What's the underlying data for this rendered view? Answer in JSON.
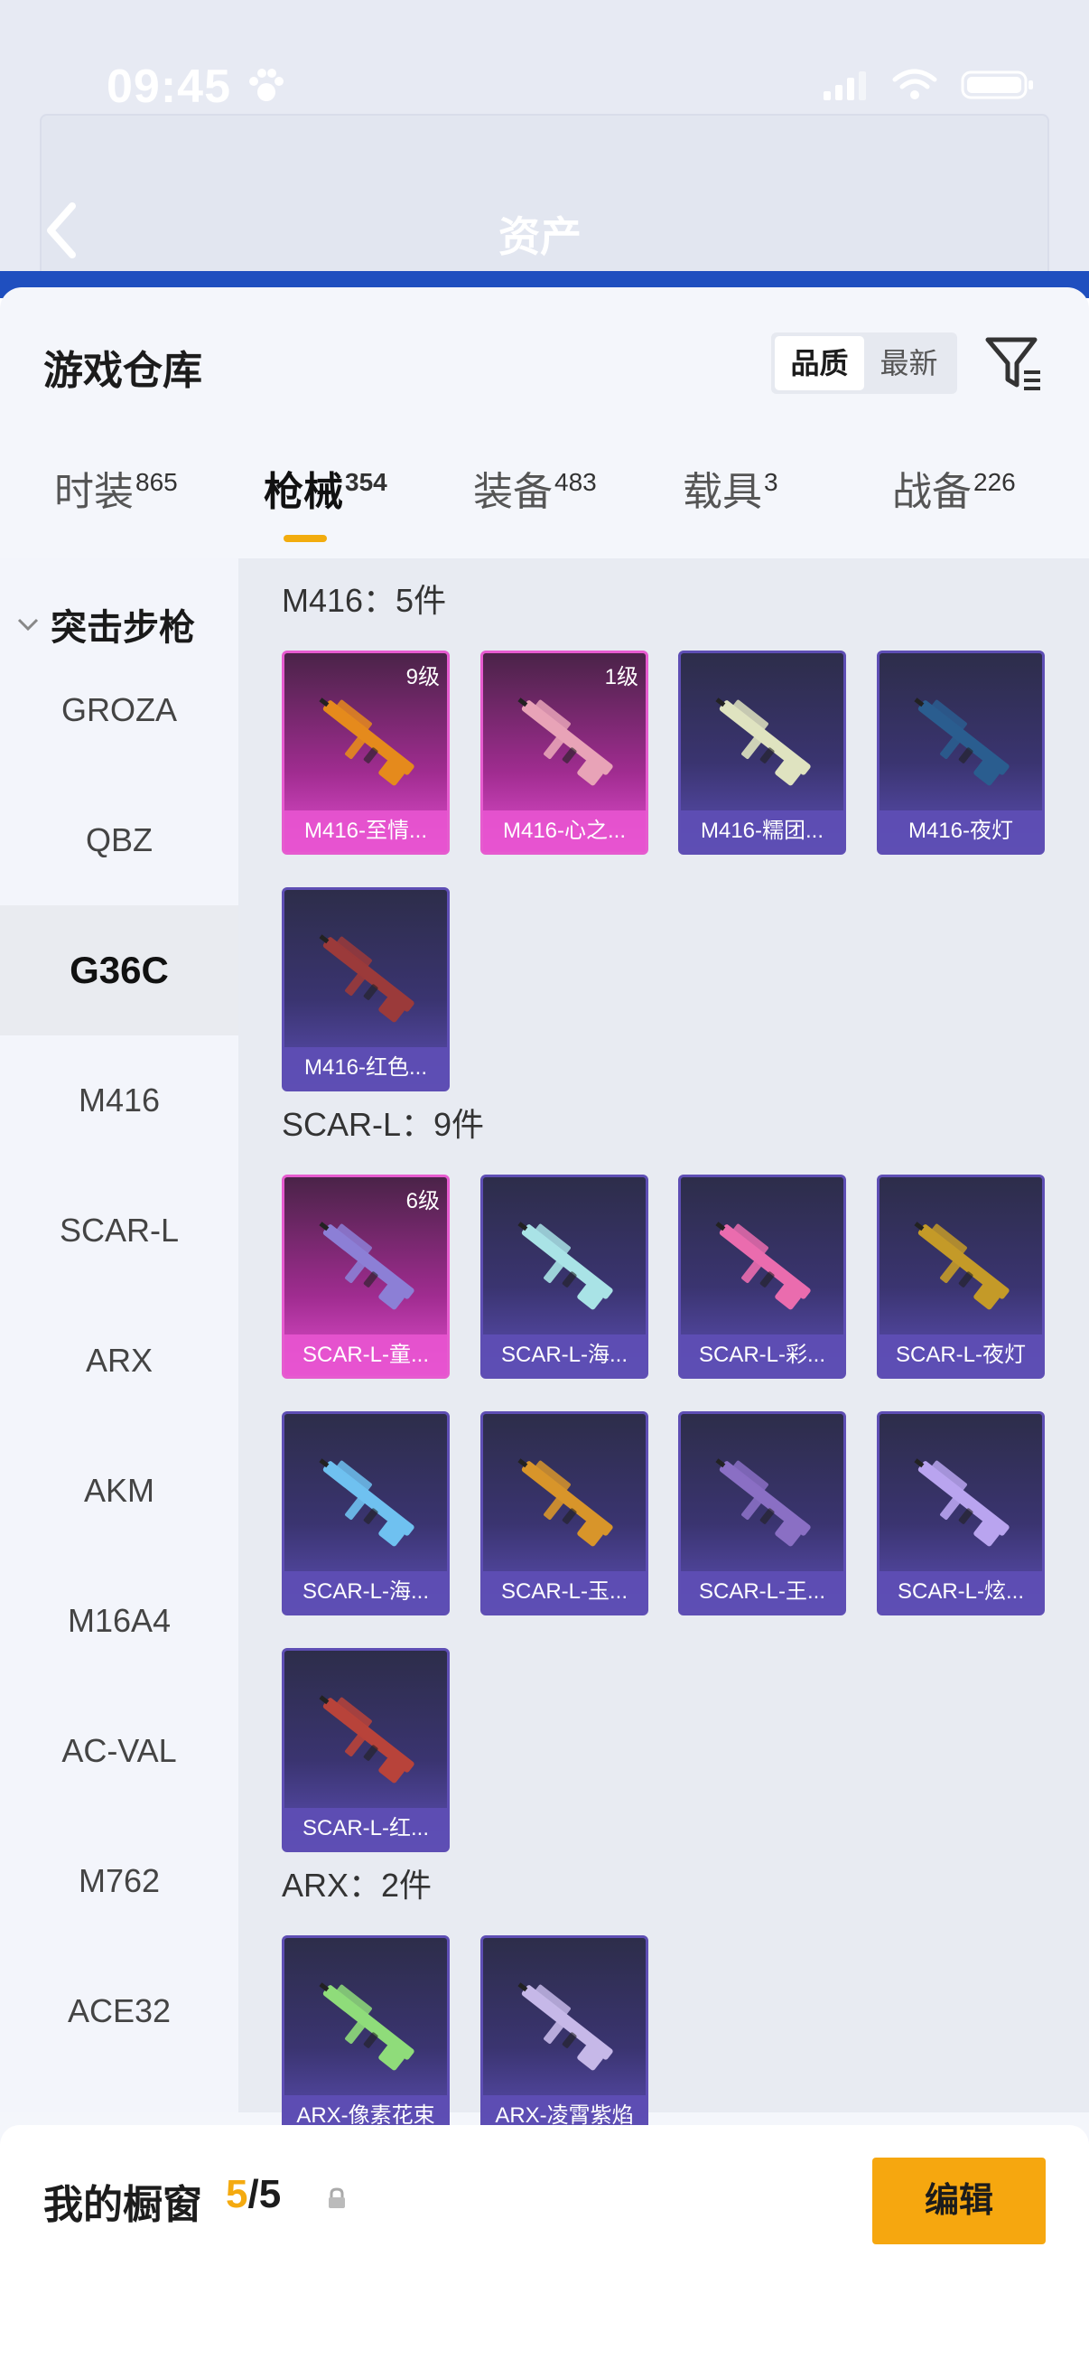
{
  "status_bar": {
    "time": "09:45"
  },
  "header": {
    "title": "资产"
  },
  "sheet": {
    "title": "游戏仓库",
    "sort_options": [
      "品质",
      "最新"
    ],
    "sort_selected": "品质"
  },
  "tabs": [
    {
      "label": "时装",
      "count": "865"
    },
    {
      "label": "枪械",
      "count": "354"
    },
    {
      "label": "装备",
      "count": "483"
    },
    {
      "label": "载具",
      "count": "3"
    },
    {
      "label": "战备",
      "count": "226"
    }
  ],
  "sidebar": {
    "group": "突击步枪",
    "items": [
      "GROZA",
      "QBZ",
      "G36C",
      "M416",
      "SCAR-L",
      "ARX",
      "AKM",
      "M16A4",
      "AC-VAL",
      "M762",
      "ACE32"
    ],
    "selected": "G36C"
  },
  "sections": [
    {
      "title": "M416：5件",
      "cards": [
        {
          "name": "M416-至情...",
          "level": "9级",
          "rarity": "pink",
          "gun_color": "#e58a1c"
        },
        {
          "name": "M416-心之...",
          "level": "1级",
          "rarity": "pink",
          "gun_color": "#e8a3b7"
        },
        {
          "name": "M416-糯团...",
          "level": "",
          "rarity": "purple",
          "gun_color": "#dfe3c0"
        },
        {
          "name": "M416-夜灯",
          "level": "",
          "rarity": "purple",
          "gun_color": "#2a5d8f"
        },
        {
          "name": "M416-红色...",
          "level": "",
          "rarity": "purple",
          "gun_color": "#9b3a3a"
        }
      ]
    },
    {
      "title": "SCAR-L：9件",
      "cards": [
        {
          "name": "SCAR-L-童...",
          "level": "6级",
          "rarity": "pink",
          "gun_color": "#8c7fd6"
        },
        {
          "name": "SCAR-L-海...",
          "level": "",
          "rarity": "purple",
          "gun_color": "#a9e3e6"
        },
        {
          "name": "SCAR-L-彩...",
          "level": "",
          "rarity": "purple",
          "gun_color": "#ea6cae"
        },
        {
          "name": "SCAR-L-夜灯",
          "level": "",
          "rarity": "purple",
          "gun_color": "#c49a28"
        },
        {
          "name": "SCAR-L-海...",
          "level": "",
          "rarity": "purple",
          "gun_color": "#6fc1f0"
        },
        {
          "name": "SCAR-L-玉...",
          "level": "",
          "rarity": "purple",
          "gun_color": "#d8952a"
        },
        {
          "name": "SCAR-L-王...",
          "level": "",
          "rarity": "purple",
          "gun_color": "#8a6fc4"
        },
        {
          "name": "SCAR-L-炫...",
          "level": "",
          "rarity": "purple",
          "gun_color": "#b9a4ef"
        },
        {
          "name": "SCAR-L-红...",
          "level": "",
          "rarity": "purple",
          "gun_color": "#b8433a"
        }
      ]
    },
    {
      "title": "ARX：2件",
      "cards": [
        {
          "name": "ARX-像素花束",
          "level": "",
          "rarity": "purple",
          "gun_color": "#8fdc7a"
        },
        {
          "name": "ARX-凌霄紫焰",
          "level": "",
          "rarity": "purple",
          "gun_color": "#c6b8e8"
        }
      ]
    }
  ],
  "footer": {
    "label": "我的橱窗",
    "current": "5",
    "total": "/5",
    "edit_label": "编辑"
  },
  "colors": {
    "accent": "#f6a70f",
    "pink_rarity": "#e65bcf",
    "purple_rarity": "#5e4eb4"
  }
}
